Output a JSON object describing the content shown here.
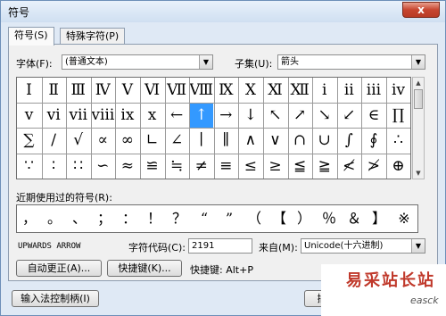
{
  "window": {
    "title": "符号",
    "close": "x"
  },
  "tabs": [
    {
      "label": "符号(S)"
    },
    {
      "label": "特殊字符(P)"
    }
  ],
  "font_label": "字体(F):",
  "font_value": "(普通文本)",
  "subset_label": "子集(U):",
  "subset_value": "箭头",
  "symbols": [
    [
      "Ⅰ",
      "Ⅱ",
      "Ⅲ",
      "Ⅳ",
      "Ⅴ",
      "Ⅵ",
      "Ⅶ",
      "Ⅷ",
      "Ⅸ",
      "Ⅹ",
      "Ⅺ",
      "Ⅻ",
      "ⅰ",
      "ⅱ",
      "ⅲ",
      "ⅳ"
    ],
    [
      "ⅴ",
      "ⅵ",
      "ⅶ",
      "ⅷ",
      "ⅸ",
      "ⅹ",
      "←",
      "↑",
      "→",
      "↓",
      "↖",
      "↗",
      "↘",
      "↙",
      "∈",
      "∏"
    ],
    [
      "∑",
      "∕",
      "√",
      "∝",
      "∞",
      "∟",
      "∠",
      "∣",
      "∥",
      "∧",
      "∨",
      "∩",
      "∪",
      "∫",
      "∮",
      "∴"
    ],
    [
      "∵",
      "∶",
      "∷",
      "∽",
      "≈",
      "≌",
      "≒",
      "≠",
      "≡",
      "≤",
      "≥",
      "≦",
      "≧",
      "≮",
      "≯",
      "⊕"
    ]
  ],
  "selected_symbol": {
    "row": 1,
    "col": 7
  },
  "recent_label": "近期使用过的符号(R):",
  "recent": [
    "，",
    "。",
    "、",
    "；",
    "：",
    "！",
    "？",
    "“",
    "”",
    "（",
    "【",
    "）",
    "％",
    "＆",
    "】",
    "※"
  ],
  "char_name": "UPWARDS ARROW",
  "char_code_label": "字符代码(C):",
  "char_code_value": "2191",
  "from_label": "来自(M):",
  "from_value": "Unicode(十六进制)",
  "buttons": {
    "autocorrect": "自动更正(A)...",
    "shortcut": "快捷键(K)...",
    "ime": "输入法控制柄(I)",
    "insert": "插"
  },
  "shortcut_label": "快捷键: Alt+P",
  "watermark": {
    "text": "易采站长站",
    "sub": "easck"
  }
}
